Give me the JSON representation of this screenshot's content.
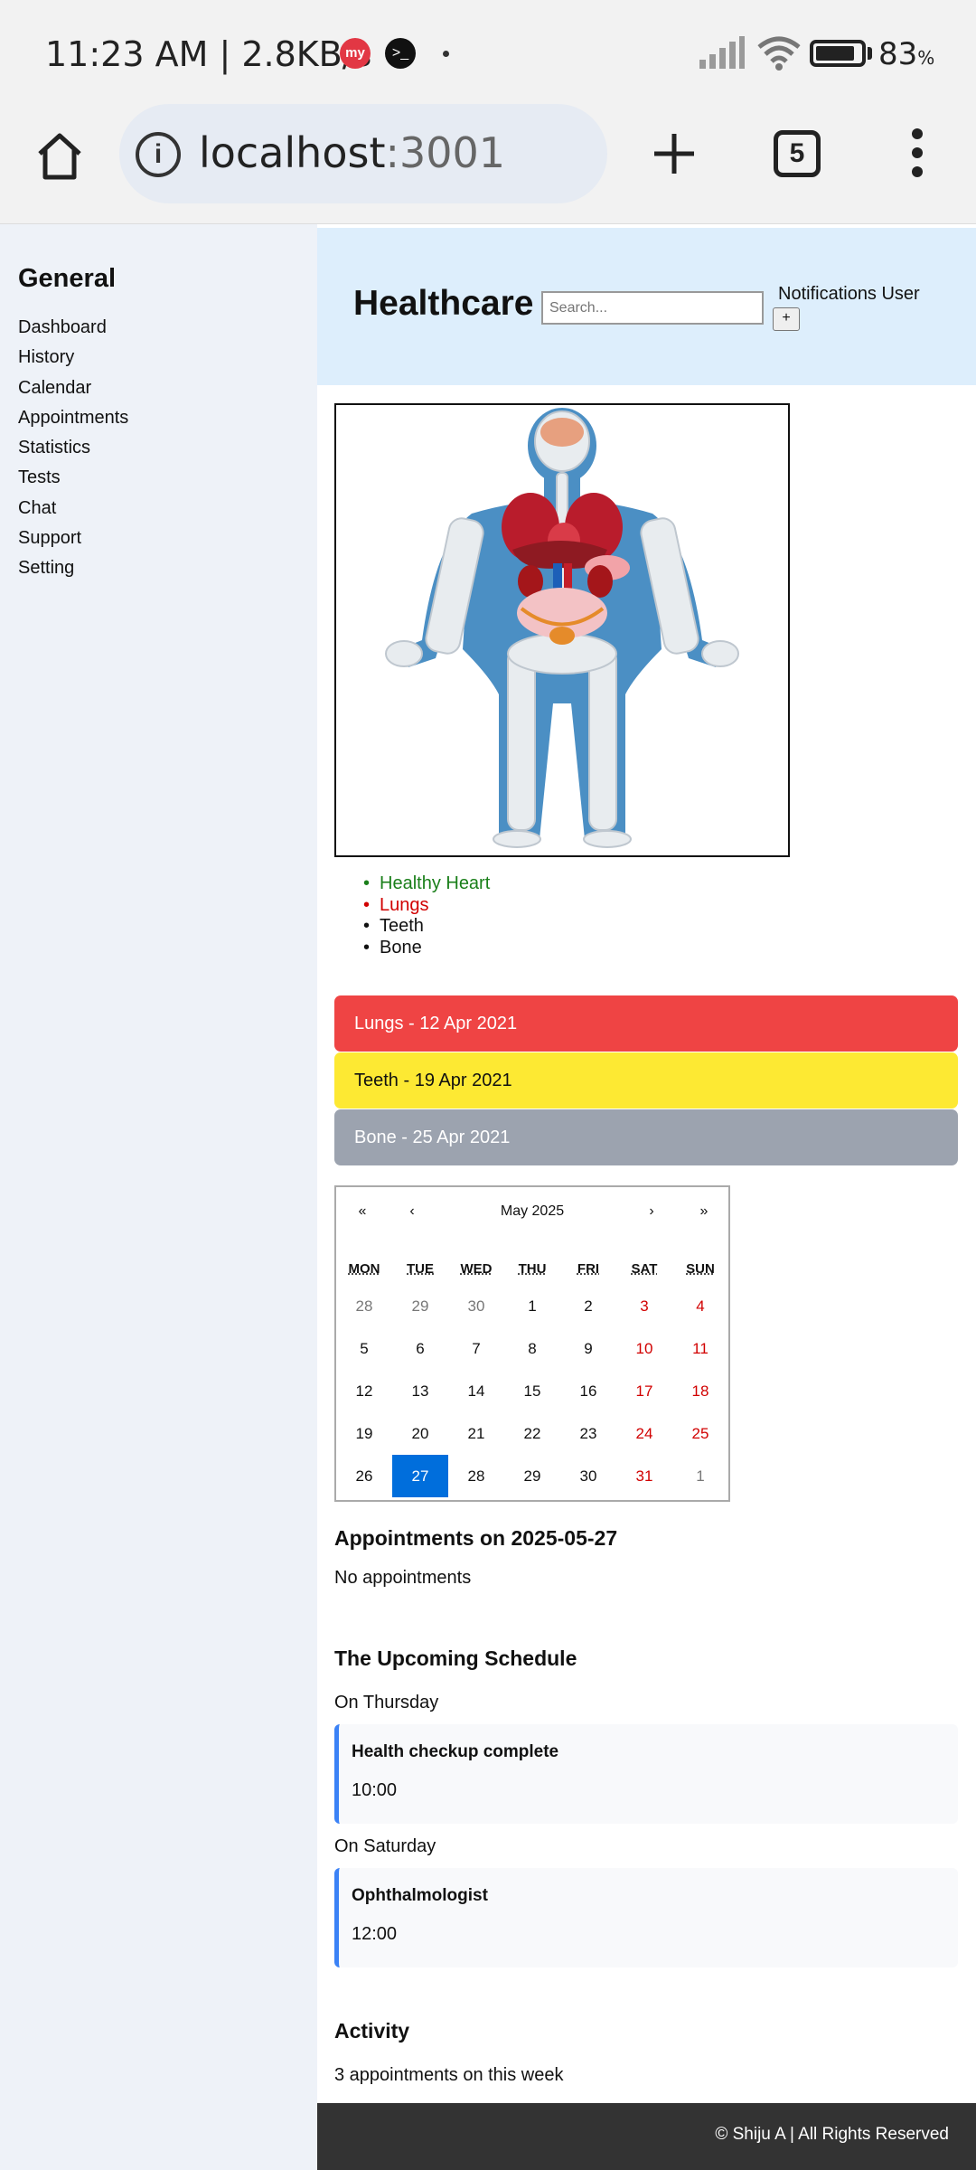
{
  "status_bar": {
    "time_speed": "11:23 AM | 2.8KB/s",
    "battery": "83",
    "battery_unit": "%"
  },
  "browser": {
    "url_host": "localhost",
    "url_port": ":3001",
    "tab_count": "5"
  },
  "sidebar": {
    "heading": "General",
    "items": [
      "Dashboard",
      "History",
      "Calendar",
      "Appointments",
      "Statistics",
      "Tests",
      "Chat",
      "Support",
      "Setting"
    ]
  },
  "header": {
    "title": "Healthcare",
    "search_placeholder": "Search...",
    "links": "Notifications User",
    "plus": "+"
  },
  "organs": [
    {
      "label": "Healthy Heart",
      "color": "#1a7f1a"
    },
    {
      "label": "Lungs",
      "color": "#d10000"
    },
    {
      "label": "Teeth",
      "color": "#111111"
    },
    {
      "label": "Bone",
      "color": "#111111"
    }
  ],
  "alerts": [
    {
      "text": "Lungs - 12 Apr 2021",
      "color": "#ef4444"
    },
    {
      "text": "Teeth - 19 Apr 2021",
      "color": "#fde933"
    },
    {
      "text": "Bone - 25 Apr 2021",
      "color": "#9ca3af"
    }
  ],
  "calendar": {
    "month_label": "May 2025",
    "nav": {
      "first": "«",
      "prev": "‹",
      "next": "›",
      "last": "»"
    },
    "weekdays": [
      "MON",
      "TUE",
      "WED",
      "THU",
      "FRI",
      "SAT",
      "SUN"
    ],
    "weeks": [
      [
        "28",
        "29",
        "30",
        "1",
        "2",
        "3",
        "4"
      ],
      [
        "5",
        "6",
        "7",
        "8",
        "9",
        "10",
        "11"
      ],
      [
        "12",
        "13",
        "14",
        "15",
        "16",
        "17",
        "18"
      ],
      [
        "19",
        "20",
        "21",
        "22",
        "23",
        "24",
        "25"
      ],
      [
        "26",
        "27",
        "28",
        "29",
        "30",
        "31",
        "1"
      ]
    ],
    "selected": "27"
  },
  "appointments": {
    "title": "Appointments on 2025-05-27",
    "empty_text": "No appointments"
  },
  "schedule": {
    "title": "The Upcoming Schedule",
    "groups": [
      {
        "day": "On Thursday",
        "name": "Health checkup complete",
        "time": "10:00"
      },
      {
        "day": "On Saturday",
        "name": "Ophthalmologist",
        "time": "12:00"
      }
    ]
  },
  "activity": {
    "title": "Activity",
    "text": "3 appointments on this week"
  },
  "footer": {
    "text": "© Shiju A | All Rights Reserved"
  }
}
